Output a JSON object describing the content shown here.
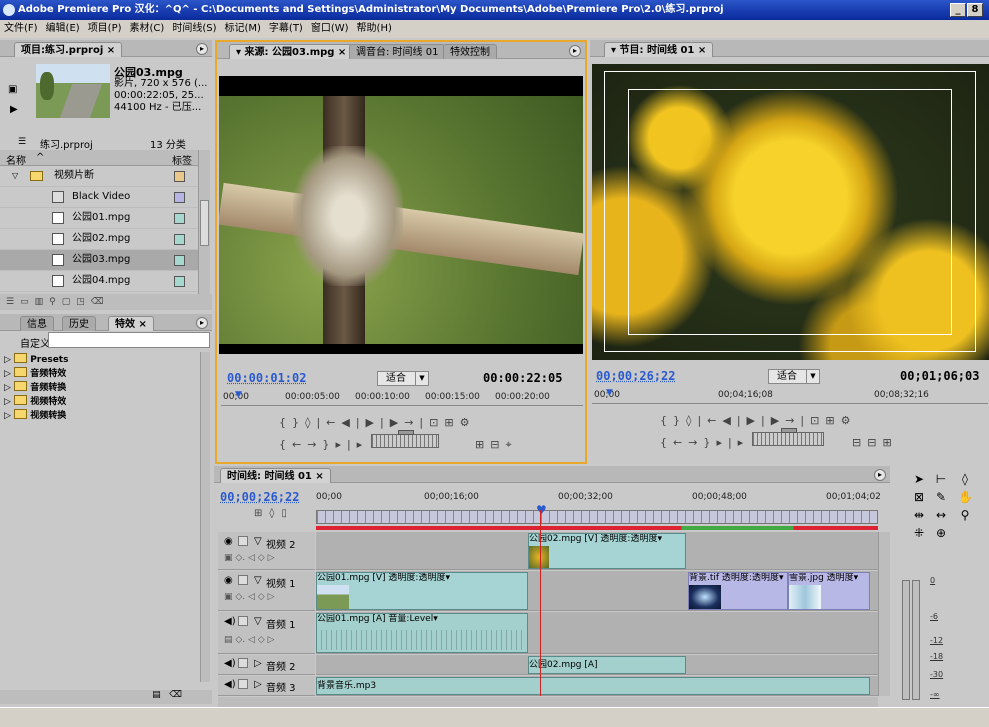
{
  "window": {
    "title": "Adobe Premiere Pro 汉化：^Q^ - C:\\Documents and Settings\\Administrator\\My Documents\\Adobe\\Premiere Pro\\2.0\\练习.prproj",
    "btn_min": "_",
    "btn_max": "8",
    "btn_close": "×"
  },
  "menu": [
    "文件(F)",
    "编辑(E)",
    "项目(P)",
    "素材(C)",
    "时间线(S)",
    "标记(M)",
    "字幕(T)",
    "窗口(W)",
    "帮助(H)"
  ],
  "project": {
    "tab": "项目:练习.prproj",
    "clip_name": "公园03.mpg",
    "clip_info": [
      "影片, 720 x 576 (...",
      "00:00:22:05, 25...",
      "44100 Hz - 已压..."
    ],
    "project_file": "练习.prproj",
    "item_count": "13 分类",
    "col_name": "名称",
    "col_label": "标签",
    "items": [
      {
        "name": "视频片断",
        "type": "folder",
        "color": "#e8c98a"
      },
      {
        "name": "Black Video",
        "type": "file",
        "color": "#b7b3e3"
      },
      {
        "name": "公园01.mpg",
        "type": "file",
        "color": "#a7d8cf"
      },
      {
        "name": "公园02.mpg",
        "type": "file",
        "color": "#a7d8cf"
      },
      {
        "name": "公园03.mpg",
        "type": "file",
        "color": "#a7d8cf",
        "selected": true
      },
      {
        "name": "公园04.mpg",
        "type": "file",
        "color": "#a7d8cf"
      }
    ]
  },
  "effects": {
    "tabs": [
      "信息",
      "历史",
      "特效"
    ],
    "custom_label": "自定义:",
    "items": [
      "Presets",
      "音频特效",
      "音频转换",
      "视频特效",
      "视频转换"
    ]
  },
  "source": {
    "tabs": [
      "来源: 公园03.mpg",
      "调音台: 时间线 01",
      "特效控制"
    ],
    "timecode": "00:00:01:02",
    "duration": "00:00:22:05",
    "fit": "适合",
    "ruler": [
      "00;00",
      "00:00:05:00",
      "00:00:10:00",
      "00:00:15:00",
      "00:00:20:00"
    ]
  },
  "program": {
    "tab": "节目: 时间线 01",
    "timecode": "00;00;26;22",
    "duration": "00;01;06;03",
    "fit": "适合",
    "ruler": [
      "00;00",
      "00;04;16;08",
      "00;08;32;16"
    ]
  },
  "timeline": {
    "tab": "时间线: 时间线 01",
    "timecode": "00;00;26;22",
    "ruler": [
      "00;00",
      "00;00;16;00",
      "00;00;32;00",
      "00;00;48;00",
      "00;01;04;02"
    ],
    "tracks": [
      {
        "name": "视频 2"
      },
      {
        "name": "视频 1"
      },
      {
        "name": "音频 1"
      },
      {
        "name": "音频 2"
      },
      {
        "name": "音频 3"
      }
    ],
    "clips": {
      "v2_clip": "公园02.mpg [V] 透明度:透明度▾",
      "v1_clip": "公园01.mpg [V] 透明度:透明度▾",
      "v1_bg_tif": "背景.tif 透明度:透明度▾",
      "v1_snow": "雪景.jpg 透明度▾",
      "a1_clip": "公园01.mpg [A] 音量:Level▾",
      "a2_clip": "公园02.mpg [A]",
      "a3_clip": "背景音乐.mp3"
    }
  },
  "meter": {
    "labels": [
      "0",
      "-6",
      "-12",
      "-18",
      "-30",
      "-∞"
    ]
  },
  "colors": {
    "accent_blue": "#2a5ad0",
    "active_border": "#e8a82a",
    "playhead": "#d02020"
  }
}
